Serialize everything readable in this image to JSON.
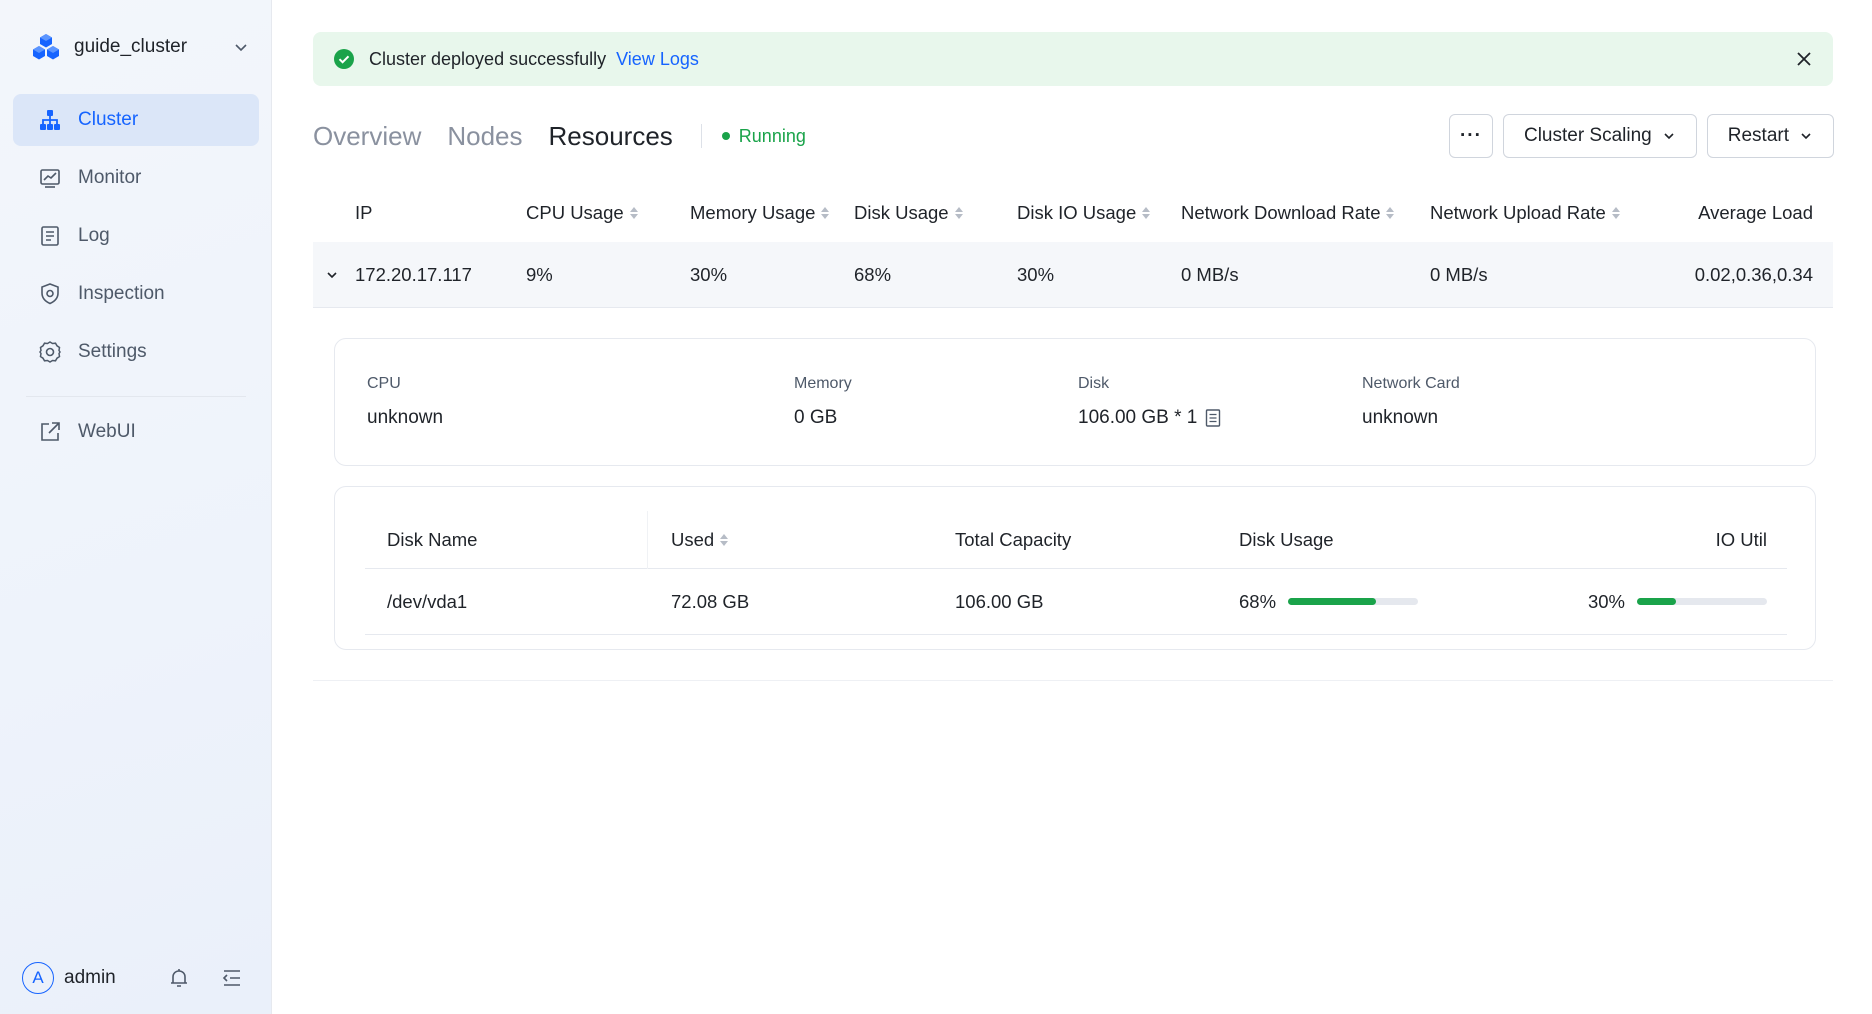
{
  "sidebar": {
    "cluster_name": "guide_cluster",
    "items": [
      {
        "label": "Cluster",
        "icon": "cluster-icon",
        "active": true
      },
      {
        "label": "Monitor",
        "icon": "monitor-icon"
      },
      {
        "label": "Log",
        "icon": "log-icon"
      },
      {
        "label": "Inspection",
        "icon": "inspection-icon"
      },
      {
        "label": "Settings",
        "icon": "gear-icon"
      }
    ],
    "webui": {
      "label": "WebUI",
      "icon": "external-link-icon"
    },
    "user": {
      "avatar_letter": "A",
      "name": "admin"
    }
  },
  "alert": {
    "message": "Cluster deployed successfully",
    "link": "View Logs"
  },
  "tabs": [
    {
      "label": "Overview"
    },
    {
      "label": "Nodes"
    },
    {
      "label": "Resources",
      "active": true
    }
  ],
  "status": "Running",
  "actions": {
    "more": "···",
    "scaling": "Cluster Scaling",
    "restart": "Restart"
  },
  "node_table": {
    "columns": [
      "IP",
      "CPU Usage",
      "Memory Usage",
      "Disk Usage",
      "Disk IO Usage",
      "Network Download Rate",
      "Network Upload Rate",
      "Average Load"
    ],
    "row": {
      "ip": "172.20.17.117",
      "cpu": "9%",
      "memory": "30%",
      "disk": "68%",
      "disk_io": "30%",
      "download": "0 MB/s",
      "upload": "0 MB/s",
      "load": "0.02,0.36,0.34"
    }
  },
  "spec": {
    "cpu_label": "CPU",
    "cpu_value": "unknown",
    "memory_label": "Memory",
    "memory_value": "0 GB",
    "disk_label": "Disk",
    "disk_value": "106.00 GB * 1",
    "nic_label": "Network Card",
    "nic_value": "unknown"
  },
  "disk_table": {
    "columns": [
      "Disk Name",
      "Used",
      "Total Capacity",
      "Disk Usage",
      "IO Util"
    ],
    "row": {
      "name": "/dev/vda1",
      "used": "72.08 GB",
      "total": "106.00 GB",
      "usage_text": "68%",
      "usage_fraction": 0.68,
      "io_text": "30%",
      "io_fraction": 0.3
    }
  },
  "colors": {
    "accent": "#1664ff",
    "success": "#1aa34a"
  }
}
